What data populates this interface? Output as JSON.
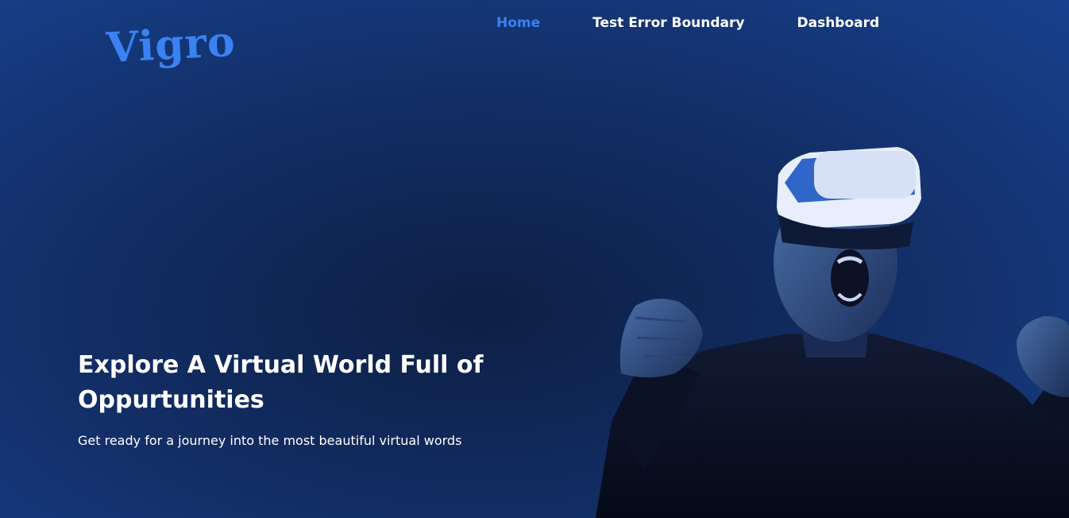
{
  "header": {
    "logo_text": "Vigro",
    "nav": [
      {
        "label": "Home",
        "active": true
      },
      {
        "label": "Test Error Boundary",
        "active": false
      },
      {
        "label": "Dashboard",
        "active": false
      }
    ]
  },
  "hero": {
    "title": "Explore A Virtual World Full of Oppurtunities",
    "subtitle": "Get ready for a journey into the most beautiful virtual words"
  },
  "colors": {
    "accent": "#3a82f2",
    "background_dark": "#0d1f44",
    "background_light": "#17418d",
    "text": "#ffffff"
  }
}
